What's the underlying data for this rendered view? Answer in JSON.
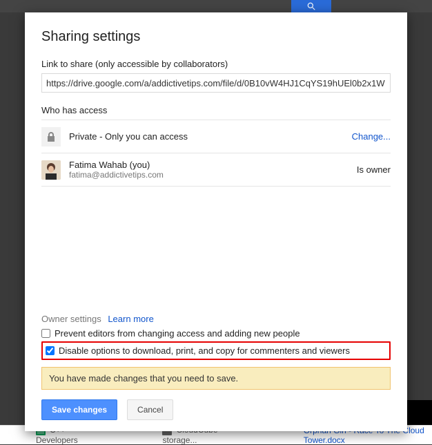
{
  "background": {
    "file1": "C++ Developers",
    "file2": "CloudCube storage...",
    "file3": "Orphan Girl - Race To The Cloud Tower.docx"
  },
  "dialog": {
    "title": "Sharing settings",
    "link_label": "Link to share (only accessible by collaborators)",
    "link_value": "https://drive.google.com/a/addictivetips.com/file/d/0B10vW4HJ1CqYS19hUEl0b2x1W",
    "access_heading": "Who has access",
    "privacy_row": {
      "text": "Private - Only you can access",
      "action": "Change..."
    },
    "user_row": {
      "name": "Fatima Wahab (you)",
      "email": "fatima@addictivetips.com",
      "role": "Is owner"
    },
    "owner_settings": {
      "label": "Owner settings",
      "learn_more": "Learn more",
      "opt_prevent_editors": "Prevent editors from changing access and adding new people",
      "opt_prevent_editors_checked": false,
      "opt_disable_download": "Disable options to download, print, and copy for commenters and viewers",
      "opt_disable_download_checked": true
    },
    "notice": "You have made changes that you need to save.",
    "save_label": "Save changes",
    "cancel_label": "Cancel"
  }
}
